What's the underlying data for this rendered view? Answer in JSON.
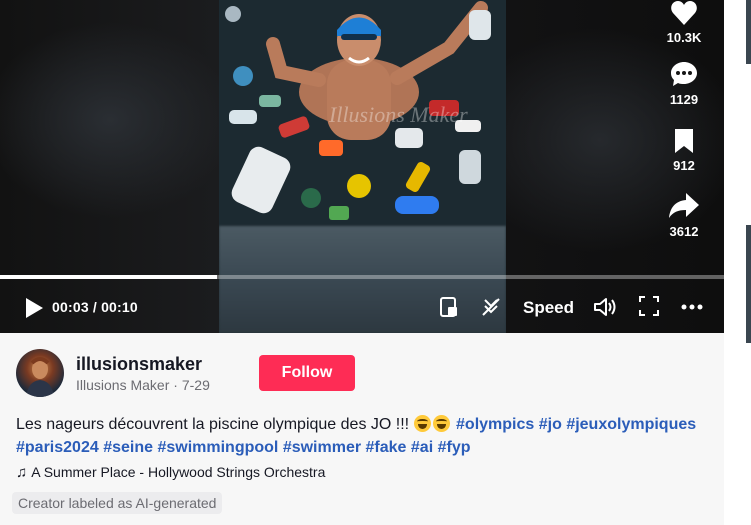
{
  "video": {
    "watermark": "Illusions Maker",
    "progress_fraction": 0.3
  },
  "actions": {
    "likes": "10.3K",
    "comments": "1129",
    "saves": "912",
    "shares": "3612"
  },
  "controls": {
    "time": "00:03 / 00:10",
    "speed_label": "Speed"
  },
  "author": {
    "username": "illusionsmaker",
    "display_name": "Illusions Maker",
    "date": "7-29",
    "follow_label": "Follow"
  },
  "caption": {
    "text": "Les nageurs découvrent la piscine olympique des JO !!!",
    "hashtags": [
      "#olympics",
      "#jo",
      "#jeuxolympiques",
      "#paris2024",
      "#seine",
      "#swimmingpool",
      "#swimmer",
      "#fake",
      "#ai",
      "#fyp"
    ]
  },
  "music": {
    "title": "A Summer Place - Hollywood Strings Orchestra"
  },
  "ai_label": "Creator labeled as AI-generated",
  "colors": {
    "follow": "#fe2c55",
    "hashtag": "#2b5db9"
  }
}
